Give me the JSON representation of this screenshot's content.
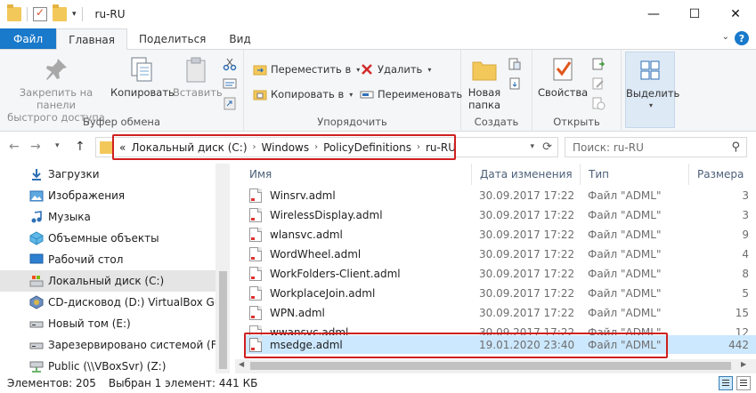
{
  "window": {
    "title": "ru-RU",
    "minimize_glyph": "—",
    "maximize_glyph": "☐",
    "close_glyph": "✕",
    "qat_dropdown_glyph": "▾"
  },
  "ribbon_tabs": [
    {
      "label": "Файл"
    },
    {
      "label": "Главная"
    },
    {
      "label": "Поделиться"
    },
    {
      "label": "Вид"
    }
  ],
  "ribbon": {
    "collapse_glyph": "⌄",
    "help_glyph": "?",
    "clipboard": {
      "pin_label_1": "Закрепить на панели",
      "pin_label_2": "быстрого доступа",
      "copy_label": "Копировать",
      "paste_label": "Вставить",
      "group_label": "Буфер обмена"
    },
    "organize": {
      "move_label": "Переместить в",
      "copy_to_label": "Копировать в",
      "delete_label": "Удалить",
      "rename_label": "Переименовать",
      "group_label": "Упорядочить"
    },
    "new": {
      "new_folder_label_1": "Новая",
      "new_folder_label_2": "папка",
      "group_label": "Создать"
    },
    "open": {
      "properties_label": "Свойства",
      "group_label": "Открыть"
    },
    "select": {
      "select_label": "Выделить"
    }
  },
  "address": {
    "overflow": "«",
    "crumbs": [
      "Локальный диск (C:)",
      "Windows",
      "PolicyDefinitions",
      "ru-RU"
    ],
    "separator": "›",
    "search_placeholder": "Поиск: ru-RU"
  },
  "nav": {
    "back_glyph": "←",
    "forward_glyph": "→",
    "up_menu_glyph": "▾",
    "up_glyph": "↑",
    "items": [
      {
        "label": "Загрузки",
        "icon": "downloads-icon"
      },
      {
        "label": "Изображения",
        "icon": "pictures-icon"
      },
      {
        "label": "Музыка",
        "icon": "music-icon"
      },
      {
        "label": "Объемные объекты",
        "icon": "3d-objects-icon"
      },
      {
        "label": "Рабочий стол",
        "icon": "desktop-icon"
      },
      {
        "label": "Локальный диск (C:)",
        "icon": "local-disk-icon"
      },
      {
        "label": "CD-дисковод (D:) VirtualBox Guest A",
        "icon": "cd-drive-icon"
      },
      {
        "label": "Новый том (E:)",
        "icon": "drive-icon"
      },
      {
        "label": "Зарезервировано системой (F:)",
        "icon": "drive-icon"
      },
      {
        "label": "Public (\\\\VBoxSvr) (Z:)",
        "icon": "network-drive-icon"
      }
    ]
  },
  "columns": {
    "name": "Имя",
    "date": "Дата изменения",
    "type": "Тип",
    "size": "Размера"
  },
  "files": [
    {
      "name": "Winsrv.adml",
      "date": "30.09.2017 17:22",
      "type": "Файл \"ADML\"",
      "size": "3"
    },
    {
      "name": "WirelessDisplay.adml",
      "date": "30.09.2017 17:22",
      "type": "Файл \"ADML\"",
      "size": "3"
    },
    {
      "name": "wlansvc.adml",
      "date": "30.09.2017 17:22",
      "type": "Файл \"ADML\"",
      "size": "9"
    },
    {
      "name": "WordWheel.adml",
      "date": "30.09.2017 17:22",
      "type": "Файл \"ADML\"",
      "size": "4"
    },
    {
      "name": "WorkFolders-Client.adml",
      "date": "30.09.2017 17:22",
      "type": "Файл \"ADML\"",
      "size": "8"
    },
    {
      "name": "WorkplaceJoin.adml",
      "date": "30.09.2017 17:22",
      "type": "Файл \"ADML\"",
      "size": "5"
    },
    {
      "name": "WPN.adml",
      "date": "30.09.2017 17:22",
      "type": "Файл \"ADML\"",
      "size": "15"
    },
    {
      "name": "wwansvc.adml",
      "date": "30.09.2017 17:22",
      "type": "Файл \"ADML\"",
      "size": "12"
    },
    {
      "name": "msedge.adml",
      "date": "19.01.2020 23:40",
      "type": "Файл \"ADML\"",
      "size": "442"
    }
  ],
  "status": {
    "count": "Элементов: 205",
    "selected": "Выбран 1 элемент: 441 КБ"
  },
  "colors": {
    "file_tab": "#1979ca",
    "highlight": "#d01f1f",
    "selection": "#cce8ff"
  }
}
